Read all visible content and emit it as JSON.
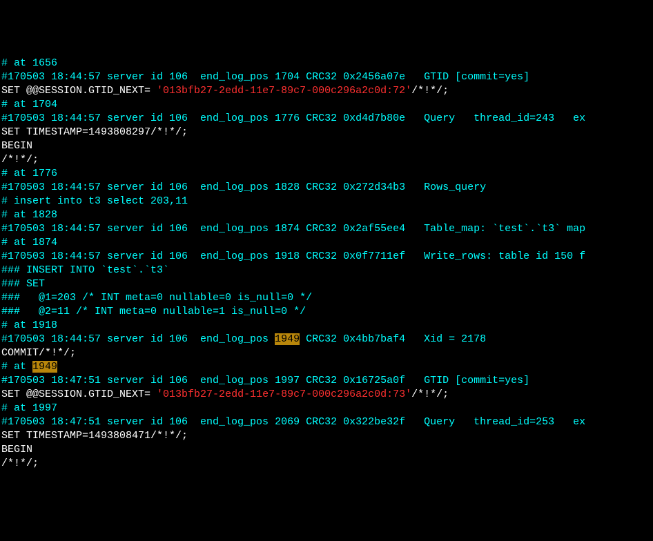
{
  "lines": [
    {
      "parts": [
        {
          "text": "# at 1656",
          "class": "cyan"
        }
      ]
    },
    {
      "parts": [
        {
          "text": "#170503 18:44:57 server id 106  end_log_pos 1704 CRC32 0x2456a07e   GTID [commit=yes]",
          "class": "cyan"
        }
      ]
    },
    {
      "parts": [
        {
          "text": "SET @@SESSION.GTID_NEXT= ",
          "class": "white"
        },
        {
          "text": "'013bfb27-2edd-11e7-89c7-000c296a2c0d:72'",
          "class": "red"
        },
        {
          "text": "/*!*/;",
          "class": "white"
        }
      ]
    },
    {
      "parts": [
        {
          "text": "# at 1704",
          "class": "cyan"
        }
      ]
    },
    {
      "parts": [
        {
          "text": "#170503 18:44:57 server id 106  end_log_pos 1776 CRC32 0xd4d7b80e   Query   thread_id=243   ex",
          "class": "cyan"
        }
      ]
    },
    {
      "parts": [
        {
          "text": "SET TIMESTAMP=1493808297/*!*/;",
          "class": "white"
        }
      ]
    },
    {
      "parts": [
        {
          "text": "BEGIN",
          "class": "white"
        }
      ]
    },
    {
      "parts": [
        {
          "text": "/*!*/;",
          "class": "white"
        }
      ]
    },
    {
      "parts": [
        {
          "text": "# at 1776",
          "class": "cyan"
        }
      ]
    },
    {
      "parts": [
        {
          "text": "#170503 18:44:57 server id 106  end_log_pos 1828 CRC32 0x272d34b3   Rows_query",
          "class": "cyan"
        }
      ]
    },
    {
      "parts": [
        {
          "text": "# insert into t3 select 203,11",
          "class": "cyan"
        }
      ]
    },
    {
      "parts": [
        {
          "text": "# at 1828",
          "class": "cyan"
        }
      ]
    },
    {
      "parts": [
        {
          "text": "#170503 18:44:57 server id 106  end_log_pos 1874 CRC32 0x2af55ee4   Table_map: `test`.`t3` map",
          "class": "cyan"
        }
      ]
    },
    {
      "parts": [
        {
          "text": "# at 1874",
          "class": "cyan"
        }
      ]
    },
    {
      "parts": [
        {
          "text": "#170503 18:44:57 server id 106  end_log_pos 1918 CRC32 0x0f7711ef   Write_rows: table id 150 f",
          "class": "cyan"
        }
      ]
    },
    {
      "parts": [
        {
          "text": "### INSERT INTO `test`.`t3`",
          "class": "cyan"
        }
      ]
    },
    {
      "parts": [
        {
          "text": "### SET",
          "class": "cyan"
        }
      ]
    },
    {
      "parts": [
        {
          "text": "###   @1=203 /* INT meta=0 nullable=0 is_null=0 */",
          "class": "cyan"
        }
      ]
    },
    {
      "parts": [
        {
          "text": "###   @2=11 /* INT meta=0 nullable=1 is_null=0 */",
          "class": "cyan"
        }
      ]
    },
    {
      "parts": [
        {
          "text": "# at 1918",
          "class": "cyan"
        }
      ]
    },
    {
      "parts": [
        {
          "text": "#170503 18:44:57 server id 106  end_log_pos ",
          "class": "cyan"
        },
        {
          "text": "1949",
          "class": "highlight"
        },
        {
          "text": " CRC32 0x4bb7baf4   Xid = 2178",
          "class": "cyan"
        }
      ]
    },
    {
      "parts": [
        {
          "text": "COMMIT/*!*/;",
          "class": "white"
        }
      ]
    },
    {
      "parts": [
        {
          "text": "# at ",
          "class": "cyan"
        },
        {
          "text": "1949",
          "class": "highlight"
        }
      ]
    },
    {
      "parts": [
        {
          "text": "#170503 18:47:51 server id 106  end_log_pos 1997 CRC32 0x16725a0f   GTID [commit=yes]",
          "class": "cyan"
        }
      ]
    },
    {
      "parts": [
        {
          "text": "SET @@SESSION.GTID_NEXT= ",
          "class": "white"
        },
        {
          "text": "'013bfb27-2edd-11e7-89c7-000c296a2c0d:73'",
          "class": "red"
        },
        {
          "text": "/*!*/;",
          "class": "white"
        }
      ]
    },
    {
      "parts": [
        {
          "text": "# at 1997",
          "class": "cyan"
        }
      ]
    },
    {
      "parts": [
        {
          "text": "#170503 18:47:51 server id 106  end_log_pos 2069 CRC32 0x322be32f   Query   thread_id=253   ex",
          "class": "cyan"
        }
      ]
    },
    {
      "parts": [
        {
          "text": "SET TIMESTAMP=1493808471/*!*/;",
          "class": "white"
        }
      ]
    },
    {
      "parts": [
        {
          "text": "BEGIN",
          "class": "white"
        }
      ]
    },
    {
      "parts": [
        {
          "text": "/*!*/;",
          "class": "white"
        }
      ]
    }
  ]
}
